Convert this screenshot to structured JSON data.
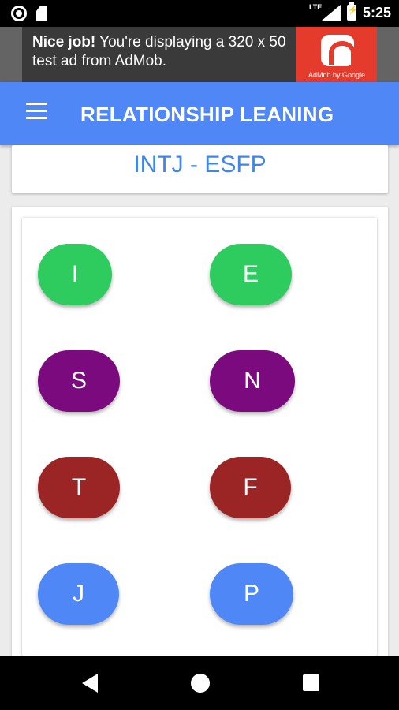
{
  "status_bar": {
    "time": "5:25",
    "network_label": "LTE",
    "icons": [
      "ring-notification-icon",
      "sd-card-icon",
      "signal-lte-icon",
      "battery-charging-icon"
    ]
  },
  "ad": {
    "headline": "Nice job!",
    "body": " You're displaying a 320 x 50 test ad from AdMob.",
    "logo_caption": "AdMob by Google",
    "colors": {
      "banner": "#3a3a3a",
      "logo_bg": "#e53b2d"
    }
  },
  "toolbar": {
    "menu_icon": "hamburger-menu-icon",
    "title": "RELATIONSHIP LEANING",
    "color": "#4f88f6"
  },
  "pair": {
    "title": "INTJ - ESFP",
    "color": "#3f86e8"
  },
  "traits": {
    "row1": {
      "left": "I",
      "right": "E",
      "color": "#2ecc5e"
    },
    "row2": {
      "left": "S",
      "right": "N",
      "color": "#7a0a7e"
    },
    "row3": {
      "left": "T",
      "right": "F",
      "color": "#9b2424"
    },
    "row4": {
      "left": "J",
      "right": "P",
      "color": "#4f88f6"
    }
  },
  "nav": {
    "icons": [
      "back-icon",
      "home-icon",
      "recents-icon"
    ]
  }
}
